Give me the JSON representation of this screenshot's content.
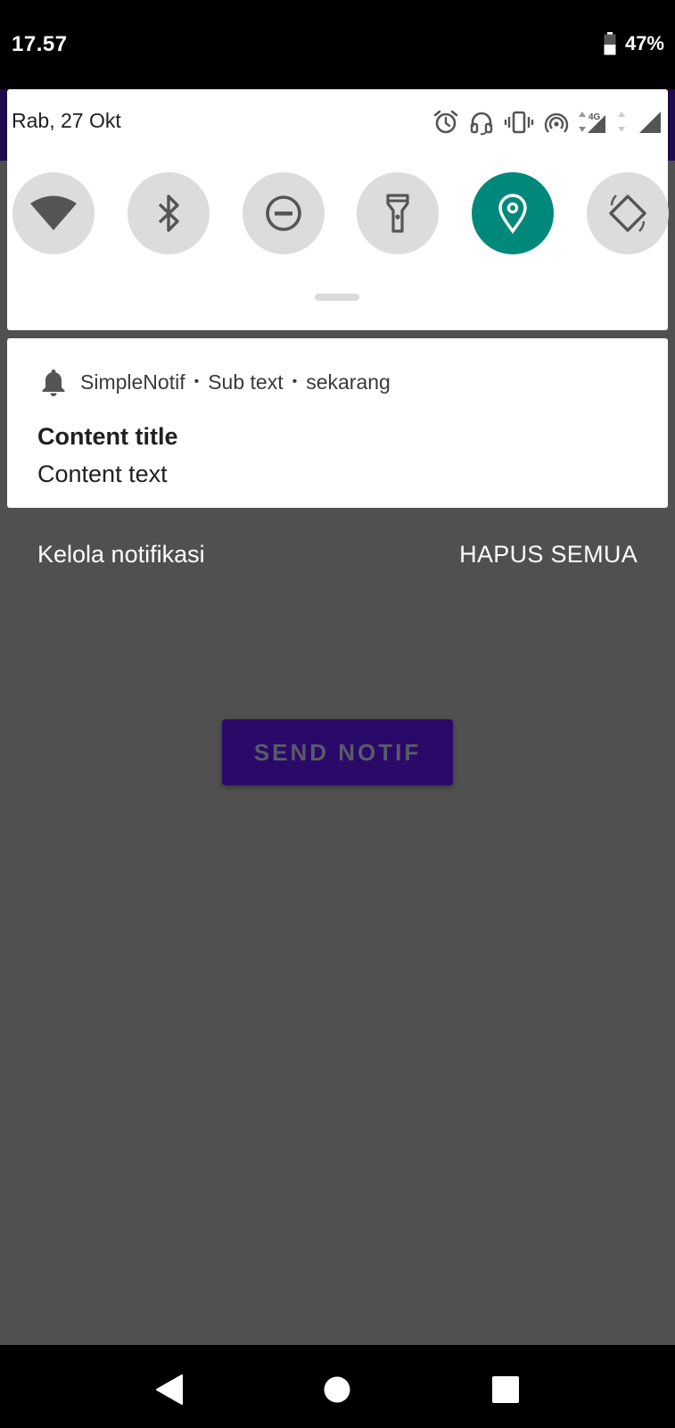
{
  "status_bar": {
    "time": "17.57",
    "battery_percent": "47%",
    "battery_level": 0.47
  },
  "quick_settings": {
    "date": "Rab, 27 Okt",
    "status_icons": [
      "alarm-icon",
      "headset-icon",
      "vibrate-icon",
      "hotspot-icon",
      "network-4g-icon",
      "signal-icon"
    ],
    "network_label": "4G",
    "tiles": [
      {
        "name": "wifi",
        "icon": "wifi-icon",
        "active": false
      },
      {
        "name": "bluetooth",
        "icon": "bluetooth-icon",
        "active": false
      },
      {
        "name": "do-not-disturb",
        "icon": "do-not-disturb-icon",
        "active": false
      },
      {
        "name": "flashlight",
        "icon": "flashlight-icon",
        "active": false
      },
      {
        "name": "location",
        "icon": "location-icon",
        "active": true
      },
      {
        "name": "auto-rotate",
        "icon": "auto-rotate-icon",
        "active": false
      }
    ],
    "active_color": "#00897b",
    "inactive_color": "#dcdcdc"
  },
  "notification": {
    "app_name": "SimpleNotif",
    "sub_text": "Sub text",
    "time": "sekarang",
    "title": "Content title",
    "text": "Content text",
    "icon": "bell-icon"
  },
  "footer": {
    "manage_label": "Kelola notifikasi",
    "clear_all_label": "HAPUS SEMUA"
  },
  "app": {
    "button_label": "SEND NOTIF",
    "accent_color": "#2a0a68"
  },
  "nav_bar": {
    "back_icon": "back-icon",
    "home_icon": "home-icon",
    "recents_icon": "recents-icon"
  }
}
